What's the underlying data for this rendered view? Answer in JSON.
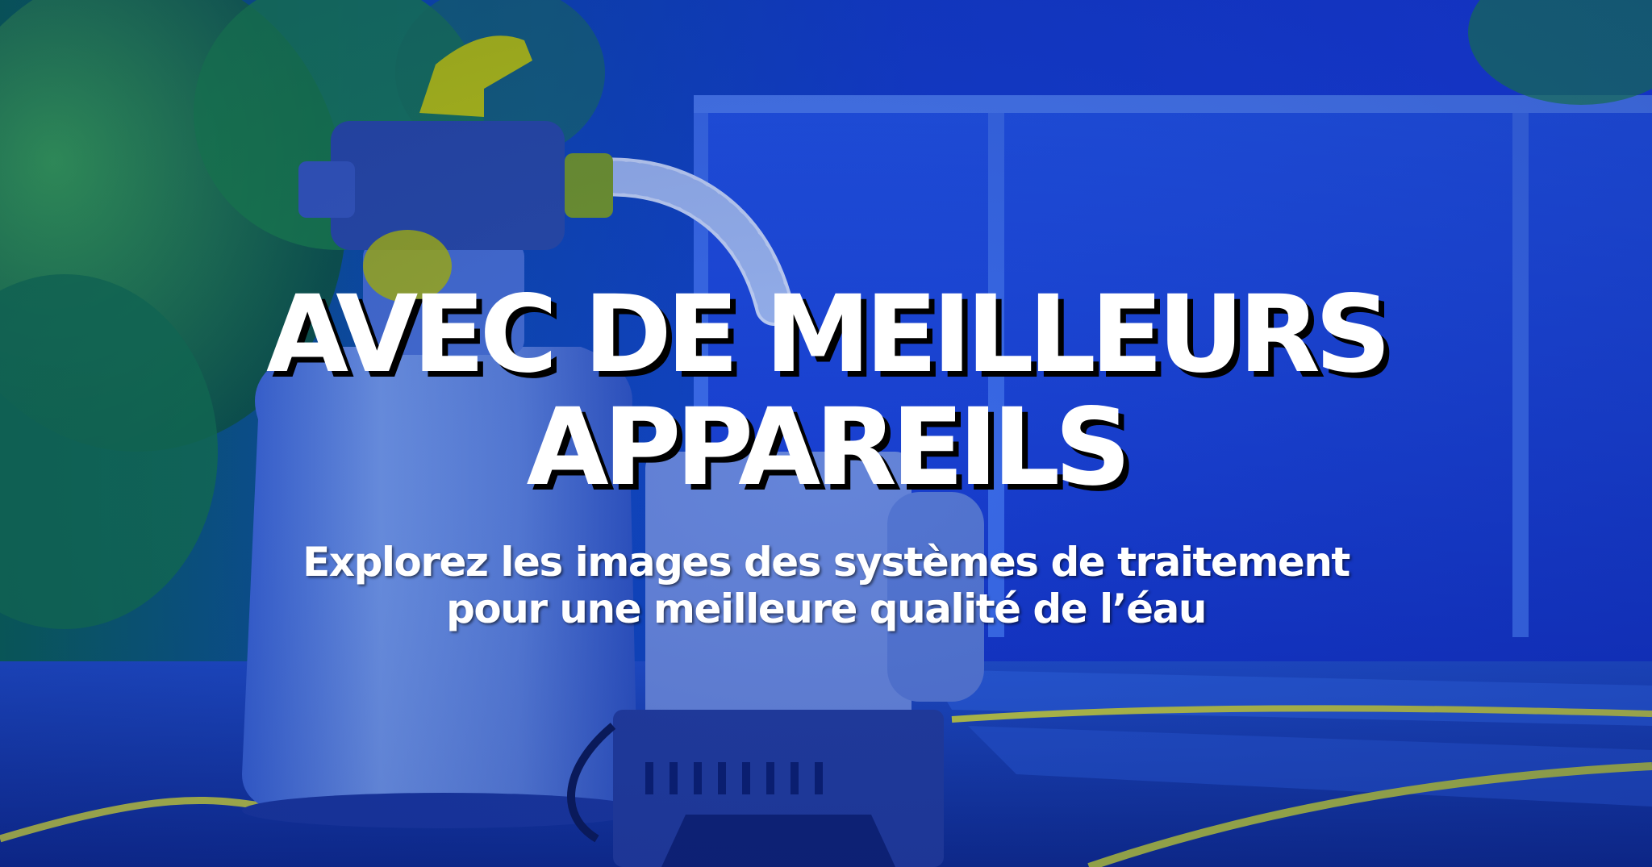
{
  "headline": {
    "line1": "AVEC DE MEILLEURS",
    "line2": "APPAREILS"
  },
  "subtitle": {
    "line1": "Explorez les images des systèmes de traitement",
    "line2": "pour une meilleure qualité de l’éau"
  },
  "colors": {
    "background_tint": "#1436c8",
    "text": "#ffffff",
    "title_shadow": "#000000",
    "foliage": "#1f8a3a",
    "valve_yellow": "#c8d400"
  }
}
